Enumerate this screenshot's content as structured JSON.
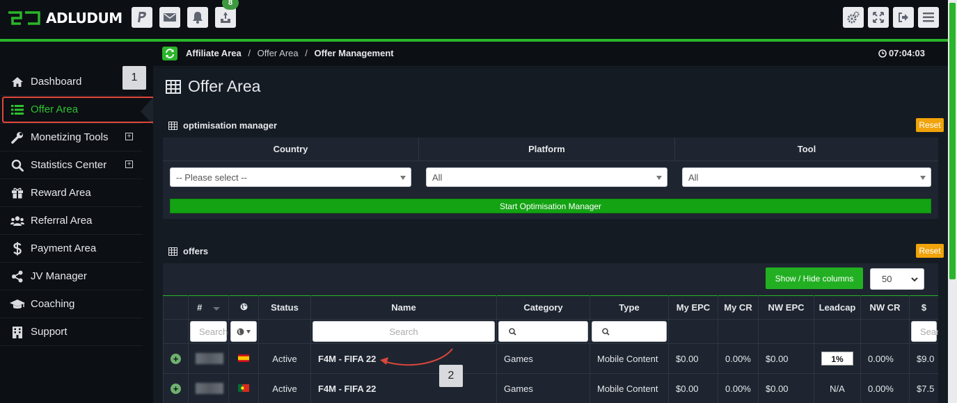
{
  "brand": {
    "logo_text": "ADLUDUM"
  },
  "topbar": {
    "icons": [
      "paypal-icon",
      "mail-icon",
      "bell-icon",
      "inbox-icon"
    ],
    "notification_count": "8",
    "right_icons": [
      "settings-icon",
      "fullscreen-icon",
      "logout-icon",
      "menu-icon"
    ]
  },
  "breadcrumb": {
    "root": "Affiliate Area",
    "sep1": "/",
    "mid": "Offer Area",
    "sep2": "/",
    "current": "Offer Management"
  },
  "clock": "07:04:03",
  "sidebar": {
    "items": [
      {
        "label": "Dashboard",
        "icon": "home-icon"
      },
      {
        "label": "Offer Area",
        "icon": "list-icon"
      },
      {
        "label": "Monetizing Tools",
        "icon": "wrench-icon"
      },
      {
        "label": "Statistics Center",
        "icon": "search-icon"
      },
      {
        "label": "Reward Area",
        "icon": "gift-icon"
      },
      {
        "label": "Referral Area",
        "icon": "users-icon"
      },
      {
        "label": "Payment Area",
        "icon": "dollar-icon"
      },
      {
        "label": "JV Manager",
        "icon": "share-icon"
      },
      {
        "label": "Coaching",
        "icon": "graduation-cap-icon"
      },
      {
        "label": "Support",
        "icon": "building-icon"
      }
    ],
    "expand_symbol": "+"
  },
  "annotations": {
    "step1": "1",
    "step2": "2"
  },
  "page": {
    "title": "Offer Area"
  },
  "optimisation": {
    "title": "optimisation manager",
    "reset_label": "Reset",
    "headers": [
      "Country",
      "Platform",
      "Tool"
    ],
    "country_value": "-- Please select --",
    "platform_value": "All",
    "tool_value": "All",
    "start_label": "Start Optimisation Manager"
  },
  "offers": {
    "title": "offers",
    "reset_label": "Reset",
    "show_hide_label": "Show / Hide columns",
    "page_size": "50",
    "columns": [
      "",
      "#",
      "",
      "Status",
      "Name",
      "Category",
      "Type",
      "My EPC",
      "My CR",
      "NW EPC",
      "Leadcap",
      "NW CR",
      "$"
    ],
    "filter_placeholders": {
      "id": "Search",
      "name": "Search",
      "dollar": "Search"
    },
    "rows": [
      {
        "status": "Active",
        "name": "F4M - FIFA 22",
        "category": "Games",
        "type": "Mobile Content",
        "my_epc": "$0.00",
        "my_cr": "0.00%",
        "nw_epc": "$0.00",
        "leadcap": "1%",
        "nw_cr": "0.00%",
        "payout": "$9.0",
        "flag": "spain-flag-icon"
      },
      {
        "status": "Active",
        "name": "F4M - FIFA 22",
        "category": "Games",
        "type": "Mobile Content",
        "my_epc": "$0.00",
        "my_cr": "0.00%",
        "nw_epc": "$0.00",
        "leadcap": "N/A",
        "nw_cr": "0.00%",
        "payout": "$7.5",
        "flag": "portugal-flag-icon"
      }
    ]
  },
  "colors": {
    "accent": "#2ab52a",
    "warning": "#f0a30a",
    "highlight": "#e0473a"
  }
}
